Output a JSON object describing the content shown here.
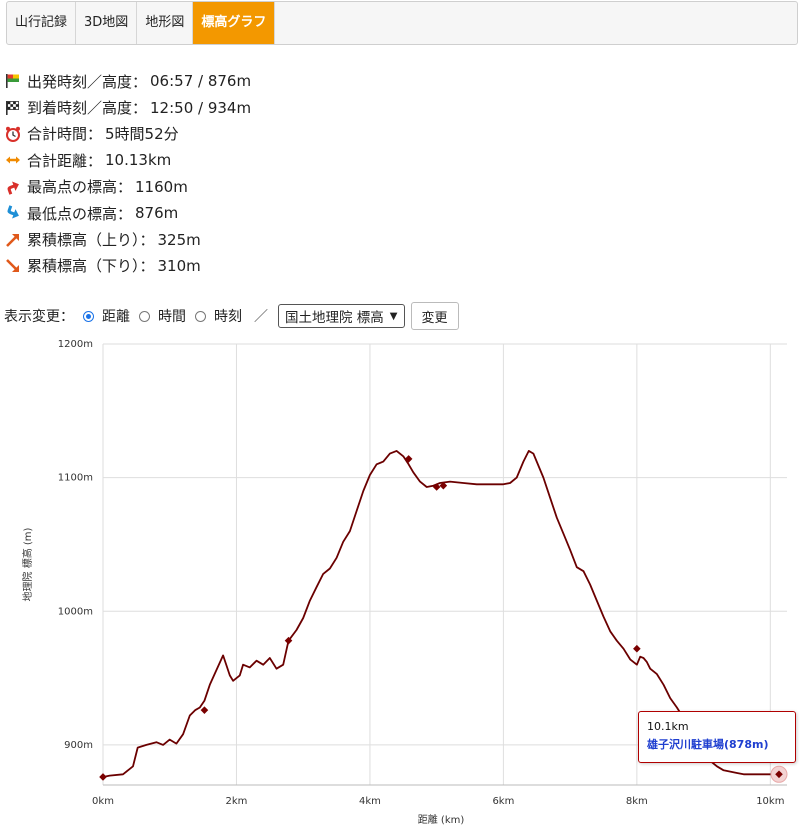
{
  "tabs": [
    {
      "label": "山行記録",
      "active": false
    },
    {
      "label": "3D地図",
      "active": false
    },
    {
      "label": "地形図",
      "active": false
    },
    {
      "label": "標高グラフ",
      "active": true
    }
  ],
  "summary": {
    "departure": {
      "label": "出発時刻／高度：",
      "value": "06:57 / 876m",
      "icon": "start-flag-icon"
    },
    "arrival": {
      "label": "到着時刻／高度：",
      "value": "12:50 / 934m",
      "icon": "checkered-flag-icon"
    },
    "total_time": {
      "label": "合計時間：",
      "value": "5時間52分",
      "icon": "alarm-clock-icon"
    },
    "total_distance": {
      "label": "合計距離：",
      "value": "10.13km",
      "icon": "left-right-arrow-icon"
    },
    "max_elevation": {
      "label": "最高点の標高：",
      "value": "1160m",
      "icon": "up-arrow-icon"
    },
    "min_elevation": {
      "label": "最低点の標高：",
      "value": "876m",
      "icon": "down-arrow-icon"
    },
    "ascent": {
      "label": "累積標高（上り）：",
      "value": "325m",
      "icon": "diagonal-up-arrow-icon"
    },
    "descent": {
      "label": "累積標高（下り）：",
      "value": "310m",
      "icon": "diagonal-down-arrow-icon"
    }
  },
  "controls": {
    "label": "表示変更：",
    "options": [
      {
        "label": "距離",
        "selected": true
      },
      {
        "label": "時間",
        "selected": false
      },
      {
        "label": "時刻",
        "selected": false
      }
    ],
    "slash": "／",
    "select_value": "国土地理院 標高",
    "button_label": "変更"
  },
  "colors": {
    "accent": "#f39800",
    "line": "#6b0000",
    "marker": "#7a0000",
    "tooltip_border": "#b00000",
    "tooltip_name": "#1f3fd0"
  },
  "tooltip": {
    "distance": "10.1km",
    "name": "雄子沢川駐車場(878m)"
  },
  "chart_data": {
    "type": "line",
    "xlabel": "距離 (km)",
    "ylabel": "地理院 標高 (m)",
    "xlim": [
      0,
      10.13
    ],
    "ylim": [
      870,
      1200
    ],
    "x_ticks": [
      0,
      2,
      4,
      6,
      8,
      10
    ],
    "x_tick_labels": [
      "0km",
      "2km",
      "4km",
      "6km",
      "8km",
      "10km"
    ],
    "y_ticks": [
      900,
      1000,
      1100,
      1200
    ],
    "y_tick_labels": [
      "900m",
      "1000m",
      "1100m",
      "1200m"
    ],
    "grid": true,
    "series": [
      {
        "x": [
          0,
          0.1,
          0.3,
          0.45,
          0.52,
          0.65,
          0.8,
          0.9,
          1.0,
          1.1,
          1.2,
          1.3,
          1.38,
          1.45,
          1.52,
          1.6,
          1.7,
          1.8,
          1.9,
          1.95,
          2.0,
          2.05,
          2.1,
          2.2,
          2.3,
          2.4,
          2.5,
          2.6,
          2.7,
          2.78,
          2.9,
          3.0,
          3.1,
          3.2,
          3.3,
          3.4,
          3.5,
          3.6,
          3.7,
          3.8,
          3.9,
          4.0,
          4.1,
          4.2,
          4.3,
          4.4,
          4.5,
          4.58,
          4.65,
          4.75,
          4.85,
          4.95,
          5.0,
          5.05,
          5.2,
          5.4,
          5.6,
          5.8,
          6.0,
          6.1,
          6.2,
          6.3,
          6.38,
          6.45,
          6.6,
          6.7,
          6.8,
          6.9,
          7.0,
          7.1,
          7.2,
          7.3,
          7.4,
          7.5,
          7.6,
          7.7,
          7.8,
          7.9,
          8.0,
          8.05,
          8.1,
          8.15,
          8.2,
          8.3,
          8.4,
          8.5,
          8.6,
          8.7,
          8.8,
          8.9,
          9.0,
          9.1,
          9.2,
          9.3,
          9.4,
          9.5,
          9.6,
          9.7,
          9.8,
          9.9,
          10.0,
          10.05,
          10.13
        ],
        "y": [
          876,
          877,
          878,
          884,
          898,
          900,
          902,
          900,
          904,
          901,
          908,
          922,
          926,
          928,
          933,
          945,
          956,
          967,
          952,
          948,
          950,
          952,
          960,
          958,
          963,
          960,
          965,
          957,
          960,
          978,
          986,
          995,
          1008,
          1018,
          1028,
          1032,
          1040,
          1052,
          1060,
          1075,
          1090,
          1102,
          1110,
          1112,
          1118,
          1120,
          1116,
          1110,
          1104,
          1097,
          1093,
          1094,
          1095,
          1096,
          1097,
          1096,
          1095,
          1095,
          1095,
          1096,
          1100,
          1112,
          1120,
          1118,
          1100,
          1085,
          1070,
          1058,
          1046,
          1033,
          1030,
          1020,
          1008,
          996,
          985,
          978,
          972,
          964,
          960,
          966,
          965,
          962,
          957,
          953,
          945,
          935,
          928,
          920,
          912,
          905,
          895,
          888,
          884,
          881,
          880,
          879,
          878,
          878,
          878,
          878,
          878,
          878,
          878
        ]
      }
    ],
    "markers": [
      {
        "x": 0,
        "y": 876
      },
      {
        "x": 1.52,
        "y": 926
      },
      {
        "x": 2.78,
        "y": 978
      },
      {
        "x": 4.58,
        "y": 1114
      },
      {
        "x": 5.0,
        "y": 1093
      },
      {
        "x": 5.1,
        "y": 1094
      },
      {
        "x": 8.0,
        "y": 972
      },
      {
        "x": 10.13,
        "y": 878
      }
    ],
    "highlight": {
      "x": 10.13,
      "y": 878
    }
  }
}
